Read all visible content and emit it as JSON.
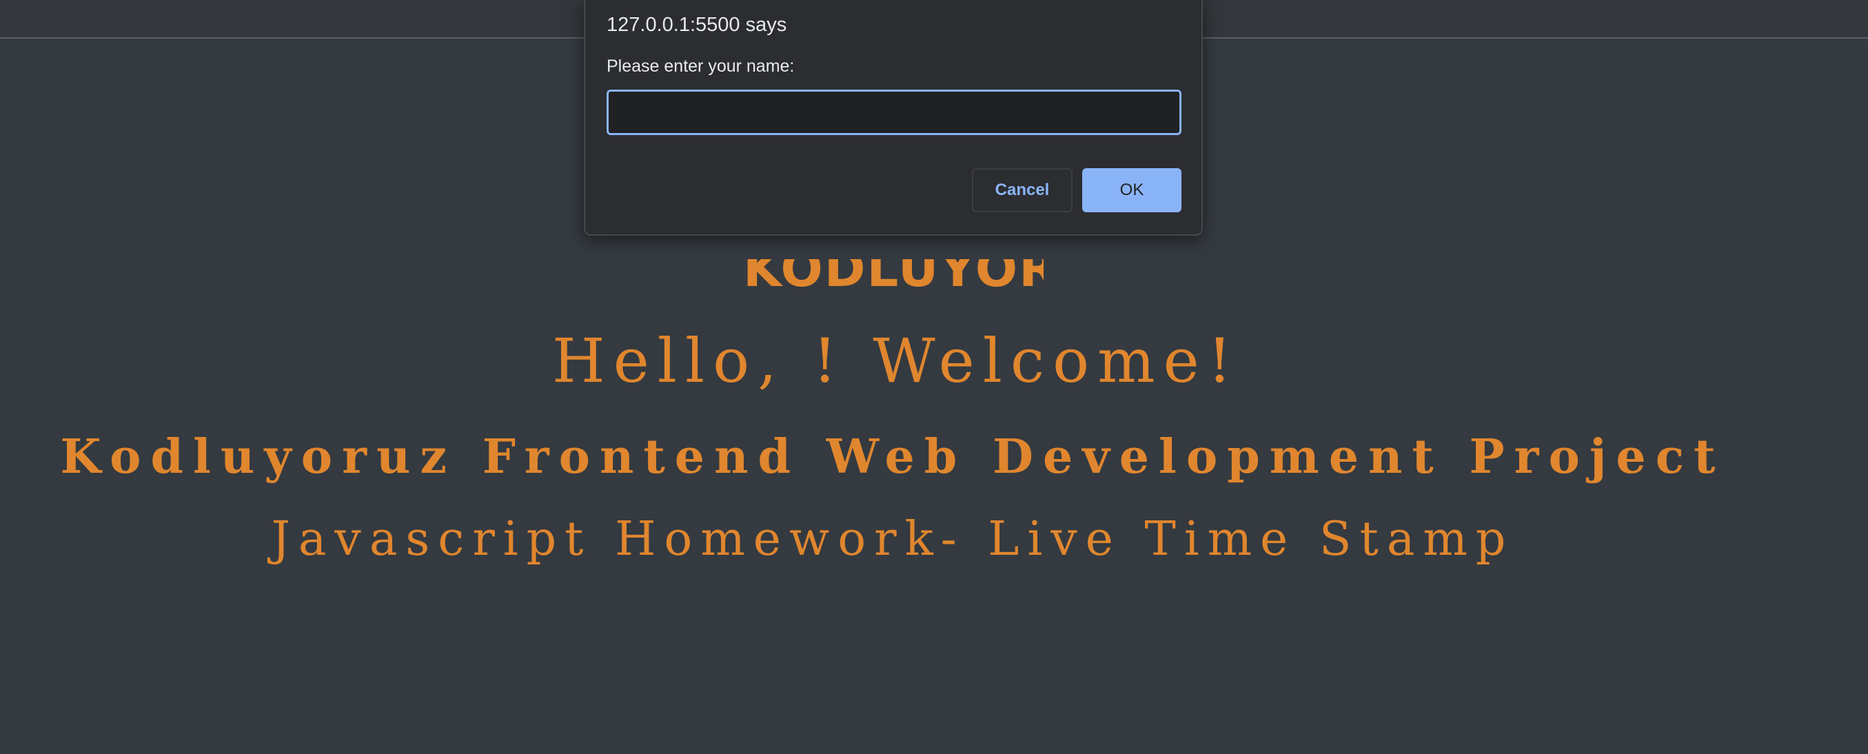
{
  "page": {
    "logo_text": "KODLUYORUZ",
    "greeting": "Hello, ! Welcome!",
    "project_title": "Kodluyoruz Frontend Web Development Project",
    "homework_title": "Javascript Homework- Live Time Stamp"
  },
  "dialog": {
    "title": "127.0.0.1:5500 says",
    "message": "Please enter your name:",
    "input_value": "",
    "cancel_label": "Cancel",
    "ok_label": "OK"
  },
  "colors": {
    "background": "#343a40",
    "accent_text": "#e0862e",
    "dialog_background": "#2c2d31",
    "dialog_accent": "#8ab4f8"
  }
}
